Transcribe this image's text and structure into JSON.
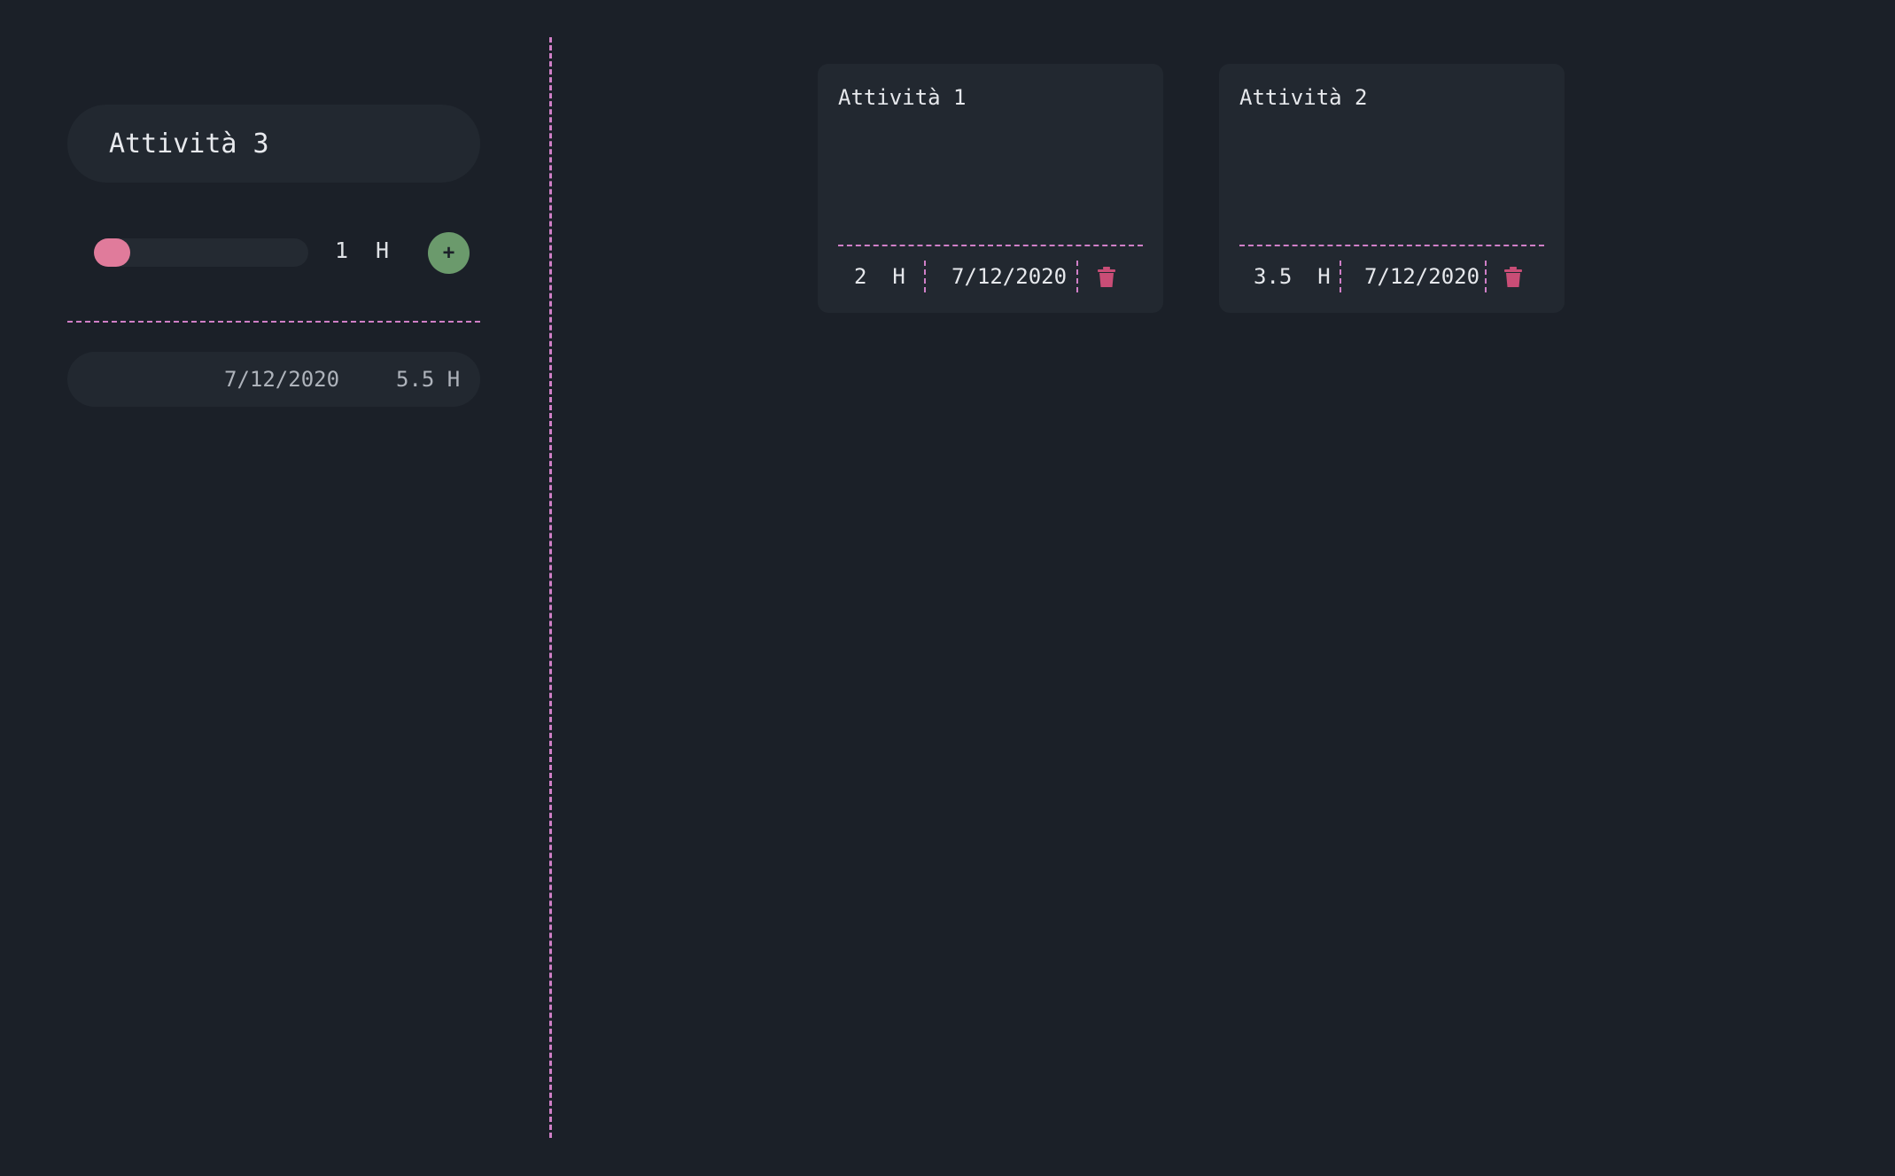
{
  "sidebar": {
    "task_input": {
      "value": "Attività 3"
    },
    "hours_slider": {
      "value": 1,
      "unit": "H",
      "fill_fraction": 0.17
    },
    "add_button": {
      "label": "+"
    },
    "summary": {
      "date": "7/12/2020",
      "total": "5.5 H"
    }
  },
  "cards": [
    {
      "title": "Attività 1",
      "hours": "2",
      "unit": "H",
      "date": "7/12/2020"
    },
    {
      "title": "Attività 2",
      "hours": "3.5",
      "unit": "H",
      "date": "7/12/2020"
    }
  ],
  "colors": {
    "background": "#1b2028",
    "surface": "#222830",
    "accent_dash": "#d07fc7",
    "slider_fill": "#e07b9b",
    "add_button": "#6b9a6c",
    "trash_icon": "#c94d76"
  },
  "icons": {
    "delete": "trash-icon",
    "add": "plus-icon"
  }
}
